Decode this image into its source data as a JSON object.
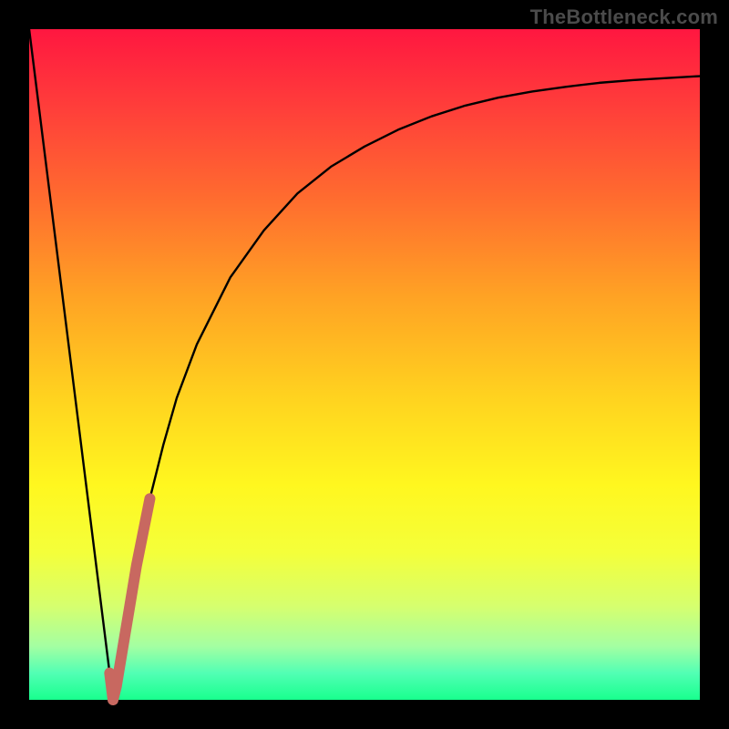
{
  "attribution": "TheBottleneck.com",
  "chart_data": {
    "type": "line",
    "title": "",
    "xlabel": "",
    "ylabel": "",
    "xlim": [
      0,
      100
    ],
    "ylim": [
      0,
      100
    ],
    "series": [
      {
        "name": "bottleneck-curve",
        "color": "#000000",
        "x": [
          0,
          3,
          6,
          9,
          12,
          12.5,
          13,
          14,
          16,
          18,
          20,
          22,
          25,
          30,
          35,
          40,
          45,
          50,
          55,
          60,
          65,
          70,
          75,
          80,
          85,
          90,
          95,
          100
        ],
        "values": [
          100,
          76,
          52,
          28,
          4,
          0,
          2,
          8,
          20,
          30,
          38,
          45,
          53,
          63,
          70,
          75.5,
          79.5,
          82.5,
          85,
          87,
          88.6,
          89.8,
          90.7,
          91.4,
          92,
          92.4,
          92.7,
          93
        ]
      },
      {
        "name": "highlight-segment",
        "color": "#c86860",
        "x": [
          12,
          12.5,
          13,
          14,
          15,
          16,
          17,
          18
        ],
        "values": [
          4,
          0,
          2,
          8,
          14,
          20,
          25,
          30
        ]
      }
    ]
  }
}
